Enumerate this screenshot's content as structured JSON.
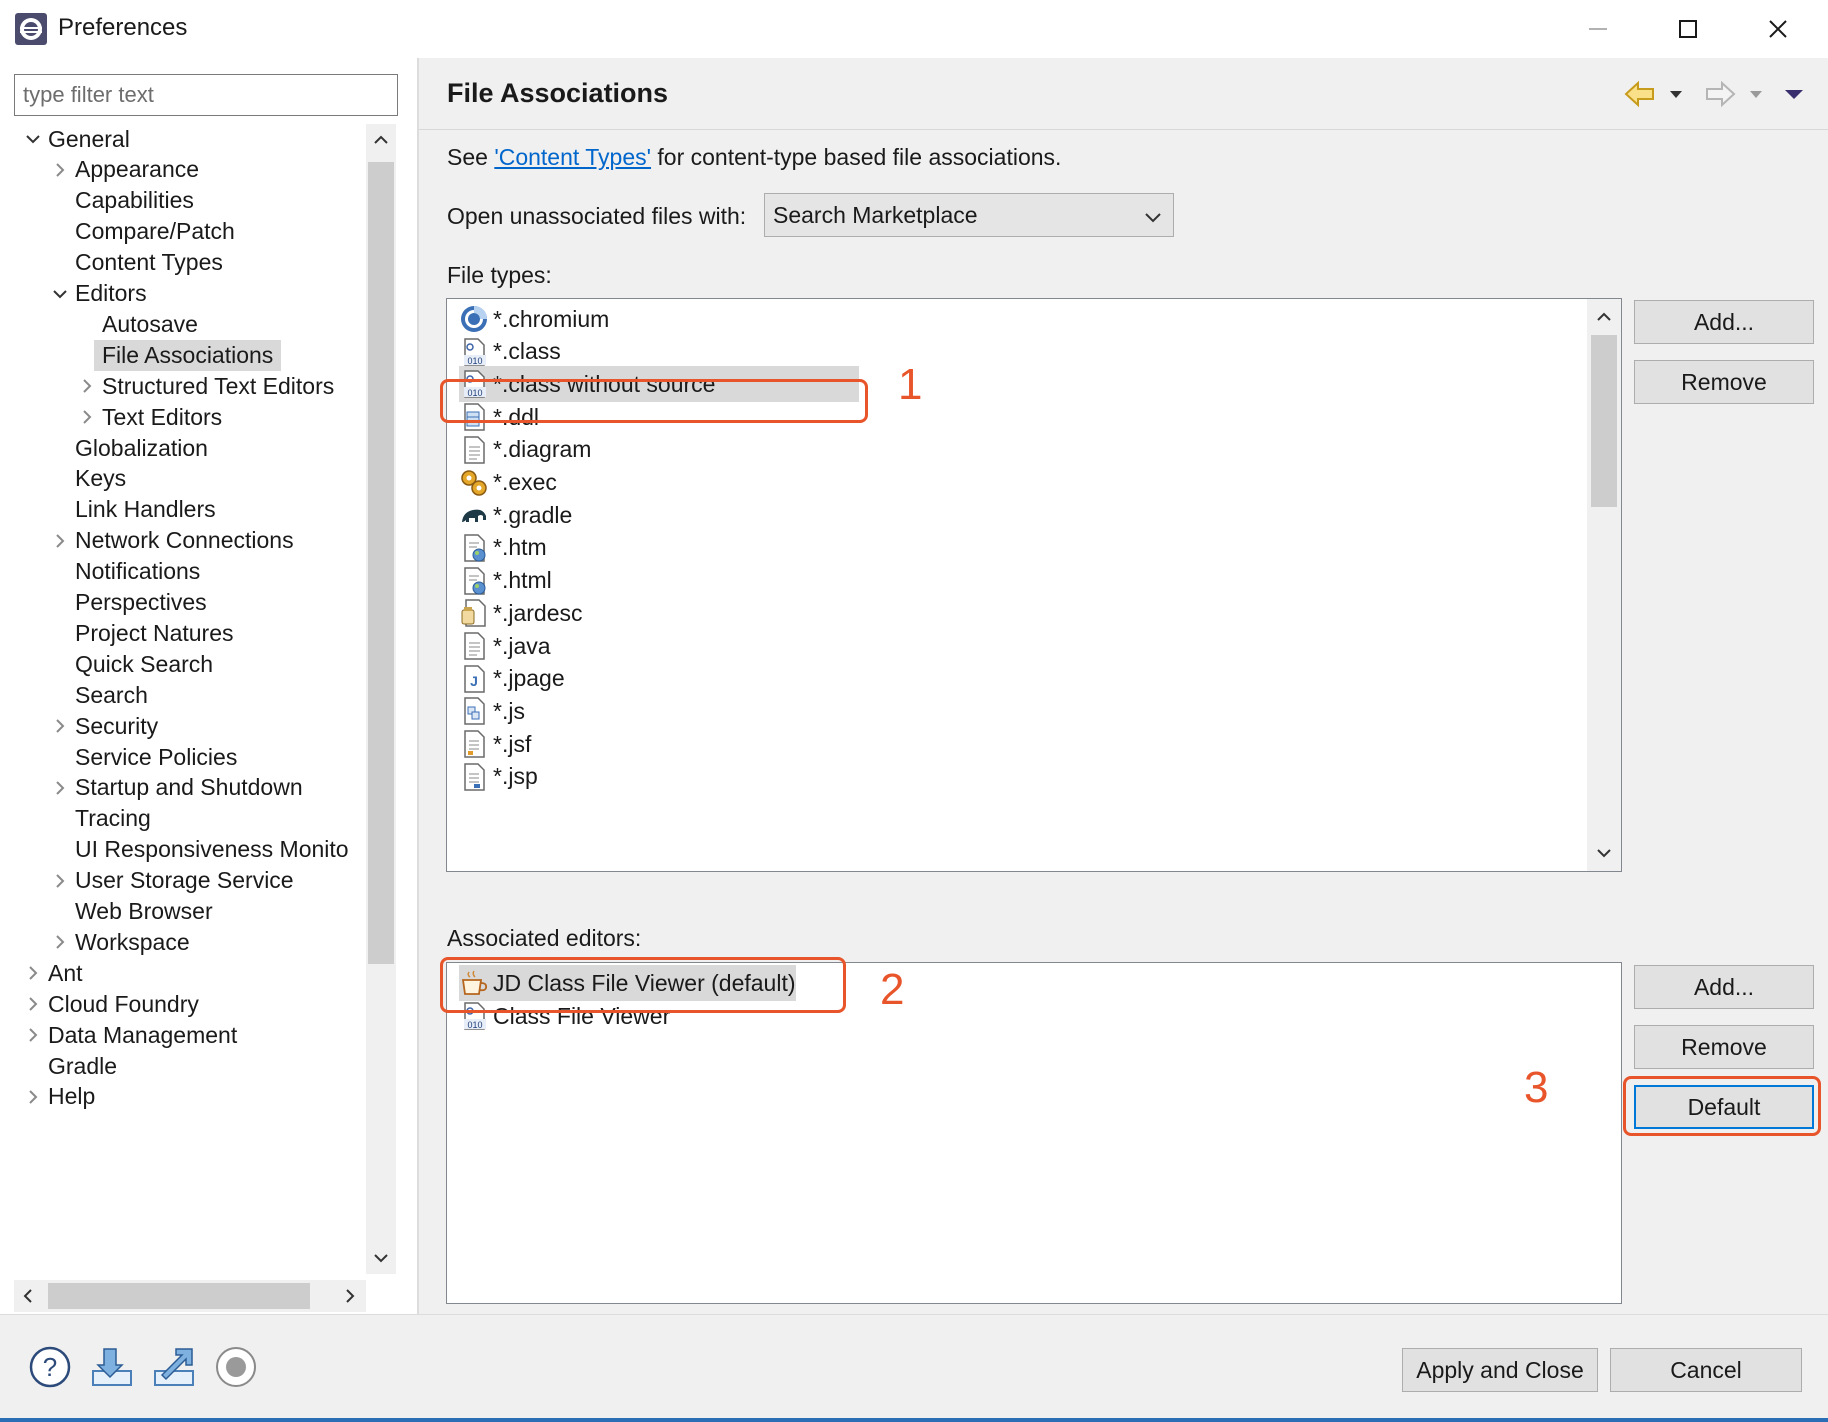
{
  "window": {
    "title": "Preferences",
    "minimize_glyph": "—",
    "maximize_glyph": "☐",
    "close_glyph": "✕"
  },
  "filter": {
    "placeholder": "type filter text",
    "value": ""
  },
  "tree": {
    "items": [
      {
        "label": "General",
        "level": 0,
        "twisty": "expanded"
      },
      {
        "label": "Appearance",
        "level": 1,
        "twisty": "collapsed"
      },
      {
        "label": "Capabilities",
        "level": 1,
        "twisty": "none"
      },
      {
        "label": "Compare/Patch",
        "level": 1,
        "twisty": "none"
      },
      {
        "label": "Content Types",
        "level": 1,
        "twisty": "none"
      },
      {
        "label": "Editors",
        "level": 1,
        "twisty": "expanded"
      },
      {
        "label": "Autosave",
        "level": 2,
        "twisty": "none"
      },
      {
        "label": "File Associations",
        "level": 2,
        "twisty": "none",
        "selected": true
      },
      {
        "label": "Structured Text Editors",
        "level": 2,
        "twisty": "collapsed"
      },
      {
        "label": "Text Editors",
        "level": 2,
        "twisty": "collapsed"
      },
      {
        "label": "Globalization",
        "level": 1,
        "twisty": "none"
      },
      {
        "label": "Keys",
        "level": 1,
        "twisty": "none"
      },
      {
        "label": "Link Handlers",
        "level": 1,
        "twisty": "none"
      },
      {
        "label": "Network Connections",
        "level": 1,
        "twisty": "collapsed"
      },
      {
        "label": "Notifications",
        "level": 1,
        "twisty": "none"
      },
      {
        "label": "Perspectives",
        "level": 1,
        "twisty": "none"
      },
      {
        "label": "Project Natures",
        "level": 1,
        "twisty": "none"
      },
      {
        "label": "Quick Search",
        "level": 1,
        "twisty": "none"
      },
      {
        "label": "Search",
        "level": 1,
        "twisty": "none"
      },
      {
        "label": "Security",
        "level": 1,
        "twisty": "collapsed"
      },
      {
        "label": "Service Policies",
        "level": 1,
        "twisty": "none"
      },
      {
        "label": "Startup and Shutdown",
        "level": 1,
        "twisty": "collapsed"
      },
      {
        "label": "Tracing",
        "level": 1,
        "twisty": "none"
      },
      {
        "label": "UI Responsiveness Monito",
        "level": 1,
        "twisty": "none"
      },
      {
        "label": "User Storage Service",
        "level": 1,
        "twisty": "collapsed"
      },
      {
        "label": "Web Browser",
        "level": 1,
        "twisty": "none"
      },
      {
        "label": "Workspace",
        "level": 1,
        "twisty": "collapsed"
      },
      {
        "label": "Ant",
        "level": 0,
        "twisty": "collapsed"
      },
      {
        "label": "Cloud Foundry",
        "level": 0,
        "twisty": "collapsed"
      },
      {
        "label": "Data Management",
        "level": 0,
        "twisty": "collapsed"
      },
      {
        "label": "Gradle",
        "level": 0,
        "twisty": "none"
      },
      {
        "label": "Help",
        "level": 0,
        "twisty": "collapsed"
      }
    ]
  },
  "page": {
    "title": "File Associations",
    "see_prefix": "See ",
    "see_link": "'Content Types'",
    "see_suffix": " for content-type based file associations.",
    "open_unassociated_label": "Open unassociated files with:",
    "open_unassociated_value": "Search Marketplace",
    "file_types_label": "File types:",
    "file_types": [
      {
        "label": "*.chromium",
        "icon": "chromium-icon"
      },
      {
        "label": "*.class",
        "icon": "binary-class-file-icon"
      },
      {
        "label": "*.class without source",
        "icon": "binary-class-file-icon",
        "selected": true
      },
      {
        "label": "*.ddl",
        "icon": "ddl-file-icon"
      },
      {
        "label": "*.diagram",
        "icon": "text-file-icon"
      },
      {
        "label": "*.exec",
        "icon": "gears-icon"
      },
      {
        "label": "*.gradle",
        "icon": "gradle-elephant-icon"
      },
      {
        "label": "*.htm",
        "icon": "html-file-icon"
      },
      {
        "label": "*.html",
        "icon": "html-file-icon"
      },
      {
        "label": "*.jardesc",
        "icon": "jar-file-icon"
      },
      {
        "label": "*.java",
        "icon": "text-file-icon"
      },
      {
        "label": "*.jpage",
        "icon": "jpage-file-icon"
      },
      {
        "label": "*.js",
        "icon": "js-file-icon"
      },
      {
        "label": "*.jsf",
        "icon": "jsf-file-icon"
      },
      {
        "label": "*.jsp",
        "icon": "jsp-file-icon"
      }
    ],
    "file_types_buttons": {
      "add": "Add...",
      "remove": "Remove"
    },
    "associated_editors_label": "Associated editors:",
    "associated_editors": [
      {
        "label": "JD Class File Viewer (default)",
        "icon": "coffee-cup-icon"
      },
      {
        "label": "Class File Viewer",
        "icon": "binary-class-file-icon"
      }
    ],
    "editor_buttons": {
      "add": "Add...",
      "remove": "Remove",
      "default": "Default"
    }
  },
  "annotations": {
    "one": "1",
    "two": "2",
    "three": "3",
    "color": "#e8552a"
  },
  "bottom": {
    "apply_and_close": "Apply and Close",
    "cancel": "Cancel"
  }
}
